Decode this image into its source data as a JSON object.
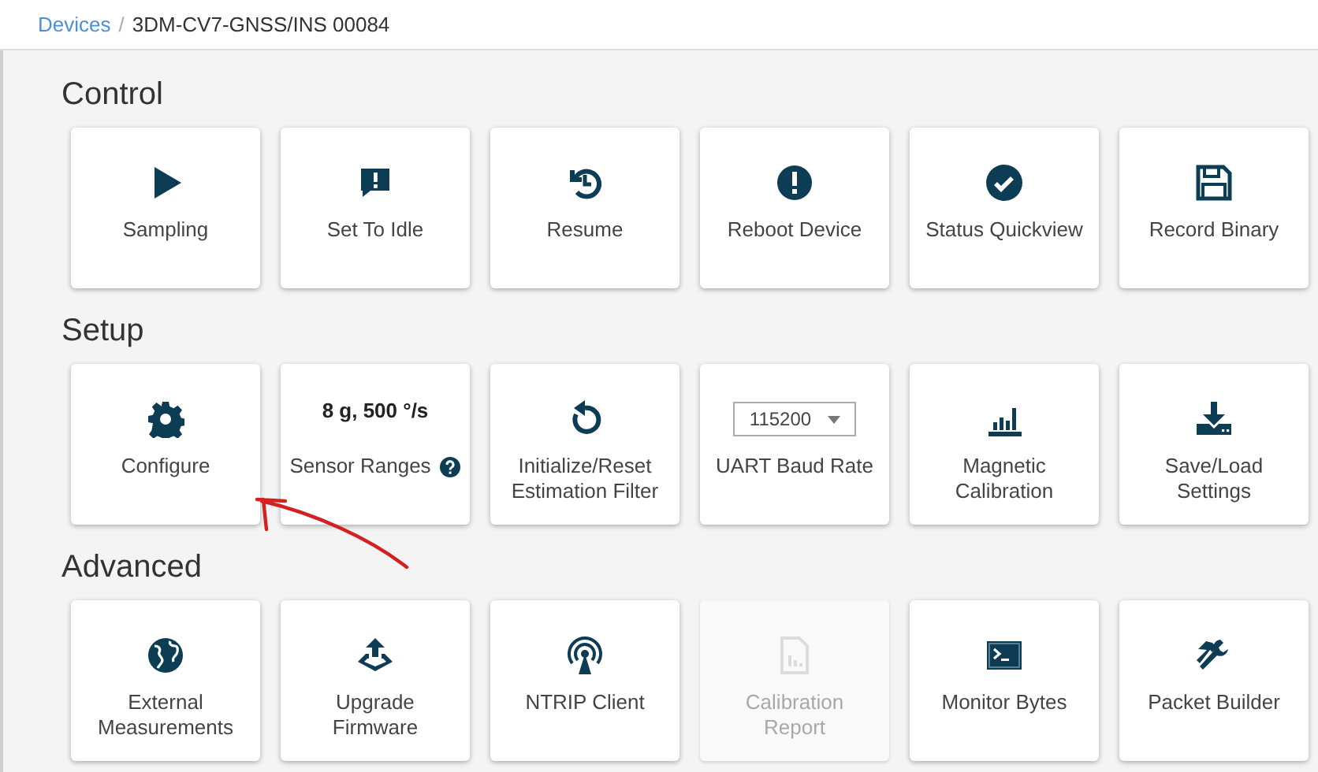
{
  "breadcrumb": {
    "link": "Devices",
    "separator": "/",
    "current": "3DM-CV7-GNSS/INS 00084"
  },
  "sections": [
    {
      "title": "Control",
      "cards": [
        {
          "kind": "icon",
          "label": "Sampling",
          "disabled": false,
          "help": false
        },
        {
          "kind": "icon",
          "label": "Set To Idle",
          "disabled": false,
          "help": false
        },
        {
          "kind": "icon",
          "label": "Resume",
          "disabled": false,
          "help": false
        },
        {
          "kind": "icon",
          "label": "Reboot Device",
          "disabled": false,
          "help": false
        },
        {
          "kind": "icon",
          "label": "Status Quickview",
          "disabled": false,
          "help": false
        },
        {
          "kind": "icon",
          "label": "Record Binary",
          "disabled": false,
          "help": false
        }
      ]
    },
    {
      "title": "Setup",
      "cards": [
        {
          "kind": "icon",
          "label": "Configure",
          "disabled": false,
          "help": false
        },
        {
          "kind": "value",
          "value": "8 g, 500 °/s",
          "label": "Sensor Ranges",
          "disabled": false,
          "help": true
        },
        {
          "kind": "icon",
          "label": "Initialize/Reset\nEstimation Filter",
          "disabled": false,
          "help": false
        },
        {
          "kind": "select",
          "value": "115200",
          "label": "UART Baud Rate",
          "disabled": false,
          "help": false
        },
        {
          "kind": "icon",
          "label": "Magnetic\nCalibration",
          "disabled": false,
          "help": false
        },
        {
          "kind": "icon",
          "label": "Save/Load\nSettings",
          "disabled": false,
          "help": false
        }
      ]
    },
    {
      "title": "Advanced",
      "cards": [
        {
          "kind": "icon",
          "label": "External\nMeasurements",
          "disabled": false,
          "help": false
        },
        {
          "kind": "icon",
          "label": "Upgrade\nFirmware",
          "disabled": false,
          "help": false
        },
        {
          "kind": "icon",
          "label": "NTRIP Client",
          "disabled": false,
          "help": false
        },
        {
          "kind": "icon",
          "label": "Calibration\nReport",
          "disabled": true,
          "help": false
        },
        {
          "kind": "icon",
          "label": "Monitor Bytes",
          "disabled": false,
          "help": false
        },
        {
          "kind": "icon",
          "label": "Packet Builder",
          "disabled": false,
          "help": false
        }
      ]
    }
  ]
}
